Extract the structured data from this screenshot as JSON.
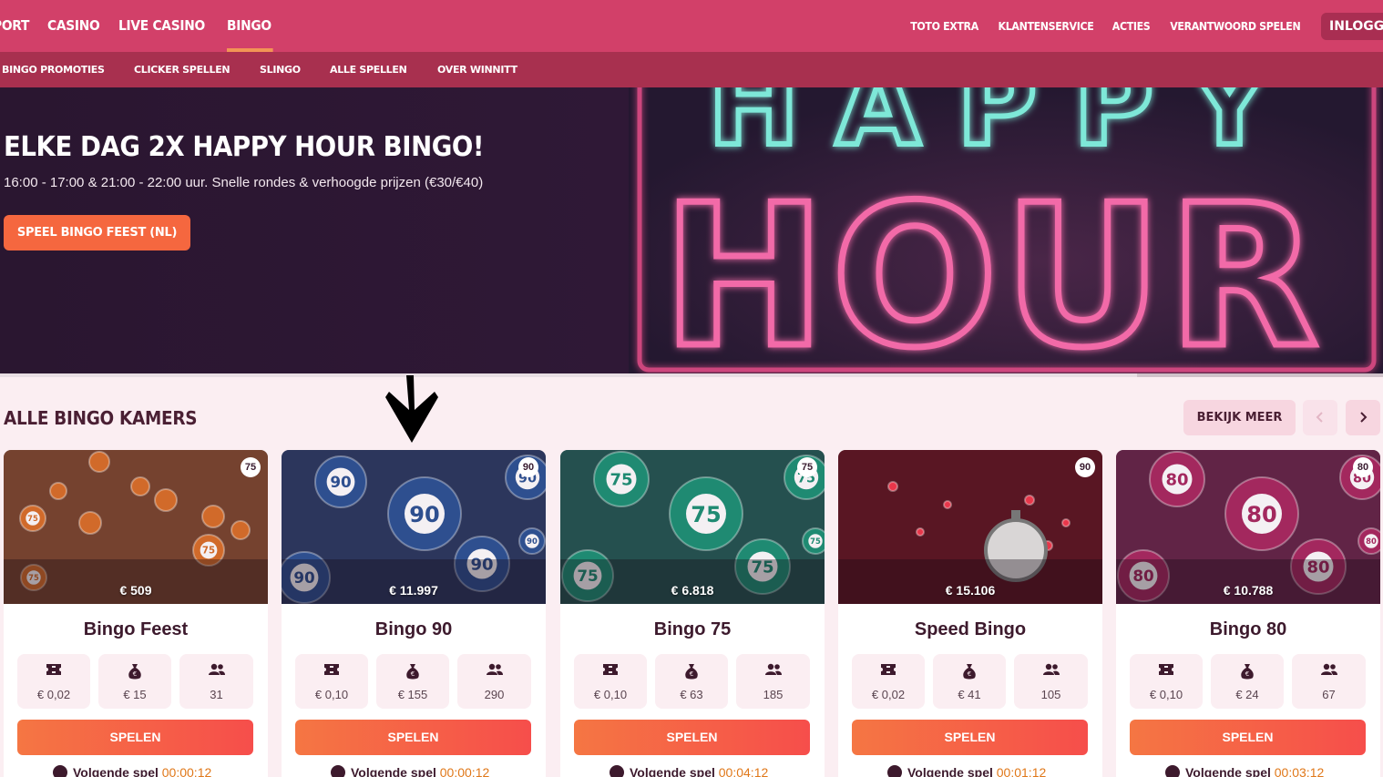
{
  "topnav": {
    "left_items": [
      "PORT",
      "CASINO",
      "LIVE CASINO",
      "BINGO"
    ],
    "right_items": [
      "TOTO EXTRA",
      "KLANTENSERVICE",
      "ACTIES",
      "VERANTWOORD SPELEN"
    ],
    "login_label": "INLOGGEN"
  },
  "subnav": {
    "items": [
      "BINGO PROMOTIES",
      "CLICKER SPELLEN",
      "SLINGO",
      "ALLE SPELLEN",
      "OVER WINNITT"
    ]
  },
  "hero": {
    "title": "ELKE DAG 2X HAPPY HOUR BINGO!",
    "subtitle": "16:00 - 17:00 & 21:00 - 22:00 uur. Snelle rondes & verhoogde prijzen (€30/€40)",
    "cta_label": "SPEEL BINGO FEEST (NL)",
    "neon_word_1": "HAPPY",
    "neon_word_2": "HOUR"
  },
  "section": {
    "title": "ALLE BINGO KAMERS",
    "more_label": "BEKIJK MEER"
  },
  "cards": [
    {
      "name": "Bingo Feest",
      "type": "75",
      "jackpot": "€ 509",
      "ticket": "€ 0,02",
      "prize": "€ 15",
      "players": "31",
      "play": "SPELEN",
      "next_label": "Volgende spel",
      "next_time": "00:00:12",
      "color": "#d16a2a"
    },
    {
      "name": "Bingo 90",
      "type": "90",
      "jackpot": "€ 11.997",
      "ticket": "€ 0,10",
      "prize": "€ 155",
      "players": "290",
      "play": "SPELEN",
      "next_label": "Volgende spel",
      "next_time": "00:00:12",
      "color": "#2e4f8f"
    },
    {
      "name": "Bingo 75",
      "type": "75",
      "jackpot": "€ 6.818",
      "ticket": "€ 0,10",
      "prize": "€ 63",
      "players": "185",
      "play": "SPELEN",
      "next_label": "Volgende spel",
      "next_time": "00:04:12",
      "color": "#1f8a72"
    },
    {
      "name": "Speed Bingo",
      "type": "90",
      "jackpot": "€ 15.106",
      "ticket": "€ 0,02",
      "prize": "€ 41",
      "players": "105",
      "play": "SPELEN",
      "next_label": "Volgende spel",
      "next_time": "00:01:12",
      "color": "#b3203a"
    },
    {
      "name": "Bingo 80",
      "type": "80",
      "jackpot": "€ 10.788",
      "ticket": "€ 0,10",
      "prize": "€ 24",
      "players": "67",
      "play": "SPELEN",
      "next_label": "Volgende spel",
      "next_time": "00:03:12",
      "color": "#a3285e"
    }
  ]
}
